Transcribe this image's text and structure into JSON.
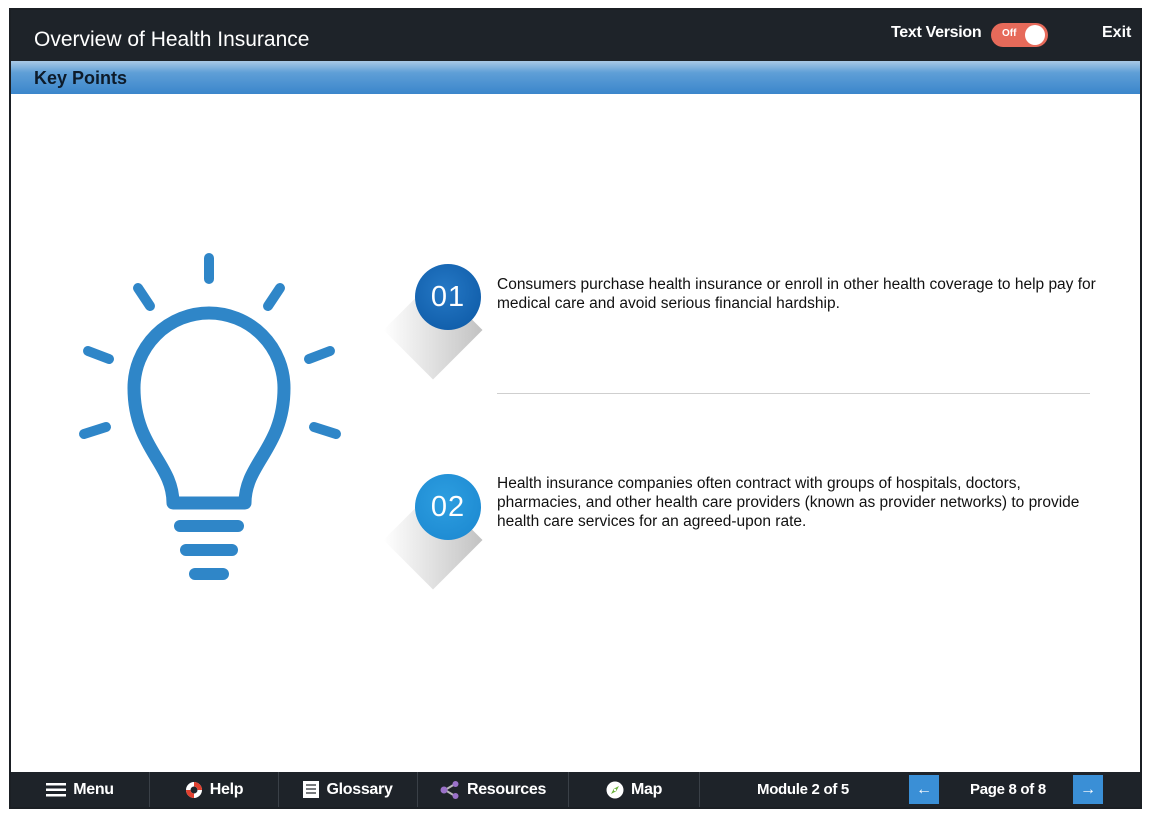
{
  "header": {
    "title": "Overview of Health Insurance",
    "text_version_label": "Text Version",
    "toggle_state": "Off",
    "exit_label": "Exit"
  },
  "section": {
    "title": "Key Points"
  },
  "points": [
    {
      "number": "01",
      "text": "Consumers purchase health insurance or enroll in other health coverage to help pay for medical care and avoid serious financial hardship.",
      "color": "#0b57a3"
    },
    {
      "number": "02",
      "text": "Health insurance companies often contract with groups of hospitals, doctors, pharmacies, and other health care providers (known as provider networks) to provide health care services for an agreed-upon rate.",
      "color": "#1a86cf"
    }
  ],
  "illustration": {
    "icon": "lightbulb-icon",
    "color": "#2f86c8"
  },
  "footer": {
    "menu_label": "Menu",
    "help_label": "Help",
    "glossary_label": "Glossary",
    "resources_label": "Resources",
    "map_label": "Map",
    "module_status": "Module 2 of 5",
    "page_status": "Page 8 of 8",
    "prev_icon": "arrow-left-icon",
    "next_icon": "arrow-right-icon"
  },
  "colors": {
    "header_bg": "#1e2329",
    "section_bar": "#3b86cb",
    "toggle_off": "#e66a5a",
    "nav_button": "#3a8fd6"
  }
}
